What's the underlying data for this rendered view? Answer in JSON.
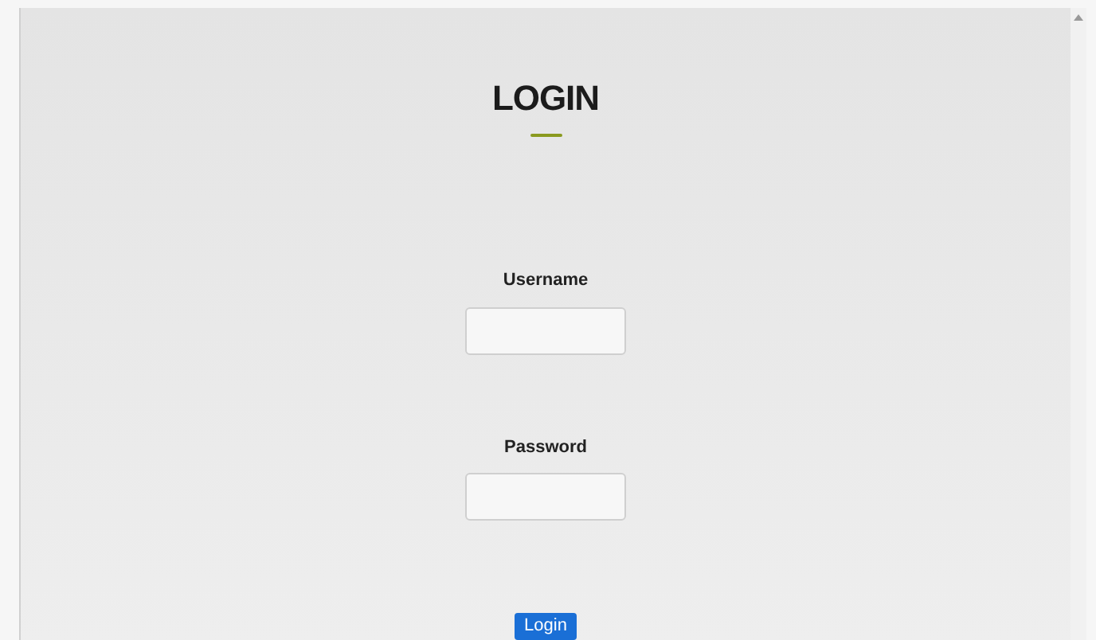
{
  "title": "LOGIN",
  "fields": [
    {
      "label": "Username"
    },
    {
      "label": "Password"
    }
  ],
  "button": "Login"
}
